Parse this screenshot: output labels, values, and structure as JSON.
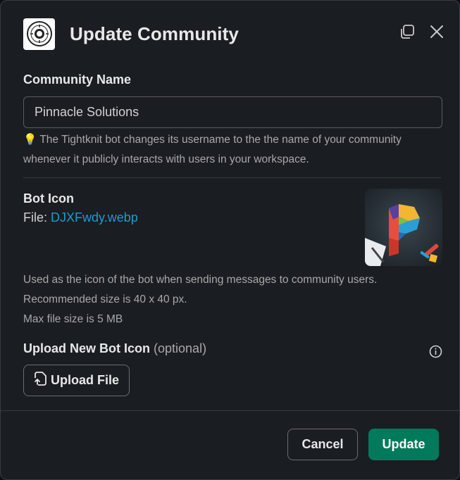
{
  "dialog": {
    "title": "Update Community",
    "icons": {
      "app": "community-seal-icon",
      "popout": "popout-icon",
      "close": "close-icon"
    }
  },
  "community_name": {
    "label": "Community Name",
    "value": "Pinnacle Solutions",
    "hint_emoji": "💡",
    "hint": "The Tightknit bot changes its username to the the name of your community whenever it publicly interacts with users in your workspace."
  },
  "bot_icon": {
    "label": "Bot Icon",
    "file_prefix": "File: ",
    "file_name": "DJXFwdy.webp",
    "description_lines": [
      "Used as the icon of the bot when sending messages to community users.",
      "Recommended size is 40 x 40 px.",
      "Max file size is 5 MB"
    ]
  },
  "upload": {
    "title": "Upload New Bot Icon",
    "optional": "(optional)",
    "button_label": "Upload File",
    "icon": "upload-file-icon"
  },
  "footer": {
    "cancel_label": "Cancel",
    "update_label": "Update"
  },
  "colors": {
    "background": "#1a1d21",
    "border": "#3a3c40",
    "link": "#1d9bd1",
    "primary": "#007a5a"
  }
}
